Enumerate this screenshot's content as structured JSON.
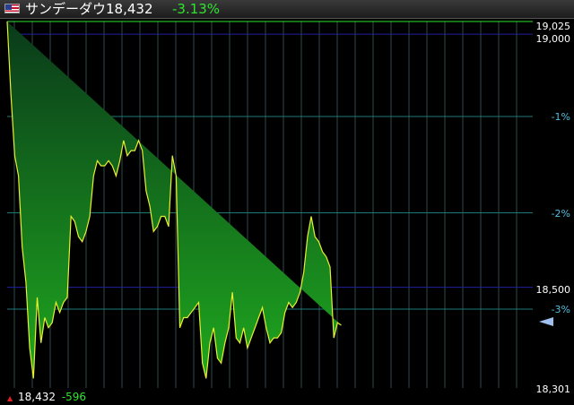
{
  "header": {
    "title": "サンデーダウ18,432",
    "change": "-3.13%"
  },
  "footer": {
    "price": "18,432",
    "change": "-596"
  },
  "colors": {
    "line": "#e8f030",
    "fill_top": "#0a3a1a",
    "fill_bottom": "#1fa81f",
    "grid_vert": "#2d4b4b",
    "pct_line": "#1e7878",
    "price_line": "#2020a0",
    "pct_label": "#4fc0e0"
  },
  "chart_data": {
    "type": "area",
    "price_labels": [
      "19,025",
      "19,000",
      "18,500",
      "18,301"
    ],
    "pct_labels": [
      "-1%",
      "-2%",
      "-3%"
    ],
    "x": [
      0,
      1,
      2,
      3,
      4,
      5,
      6,
      7,
      8,
      9,
      10,
      11,
      12,
      13,
      14,
      15,
      16,
      17,
      18,
      19,
      20,
      21,
      22,
      23,
      24,
      25,
      26,
      27,
      28,
      29,
      30,
      31,
      32,
      33,
      34,
      35,
      36,
      37,
      38,
      39,
      40,
      41,
      42,
      43,
      44,
      45,
      46,
      47,
      48,
      49,
      50,
      51,
      52,
      53,
      54,
      55,
      56,
      57,
      58,
      59,
      60,
      61,
      62,
      63,
      64,
      65,
      66,
      67,
      68,
      69,
      70,
      71,
      72,
      73,
      74,
      75,
      76,
      77,
      78,
      79,
      80,
      81,
      82,
      83,
      84,
      85,
      86,
      87,
      88,
      89,
      90,
      91,
      92,
      93,
      94,
      95,
      96,
      97,
      98,
      99,
      100,
      101,
      102,
      103,
      104,
      105,
      106,
      107,
      108,
      109,
      110,
      111,
      112,
      113,
      114,
      115,
      116,
      117,
      118,
      119,
      120,
      121,
      122,
      123,
      124,
      125,
      126,
      127,
      128,
      129,
      130,
      131,
      132,
      133,
      134,
      135,
      136,
      137,
      138,
      139,
      140
    ],
    "values": [
      19025,
      18880,
      18760,
      18720,
      18580,
      18510,
      18380,
      18320,
      18480,
      18390,
      18440,
      18420,
      18430,
      18470,
      18450,
      18470,
      18480,
      18640,
      18630,
      18600,
      18590,
      18610,
      18640,
      18720,
      18750,
      18740,
      18740,
      18750,
      18740,
      18720,
      18750,
      18790,
      18760,
      18770,
      18770,
      18790,
      18770,
      18690,
      18660,
      18610,
      18620,
      18640,
      18640,
      18620,
      18760,
      18720,
      18420,
      18440,
      18440,
      18450,
      18460,
      18470,
      18350,
      18320,
      18390,
      18420,
      18360,
      18350,
      18390,
      18420,
      18490,
      18400,
      18390,
      18420,
      18380,
      18400,
      18420,
      18440,
      18460,
      18420,
      18390,
      18400,
      18400,
      18410,
      18450,
      18470,
      18460,
      18470,
      18490,
      18530,
      18600,
      18640,
      18600,
      18590,
      18570,
      18560,
      18540,
      18400,
      18430,
      18425
    ],
    "ylim": [
      18301,
      19025
    ]
  }
}
